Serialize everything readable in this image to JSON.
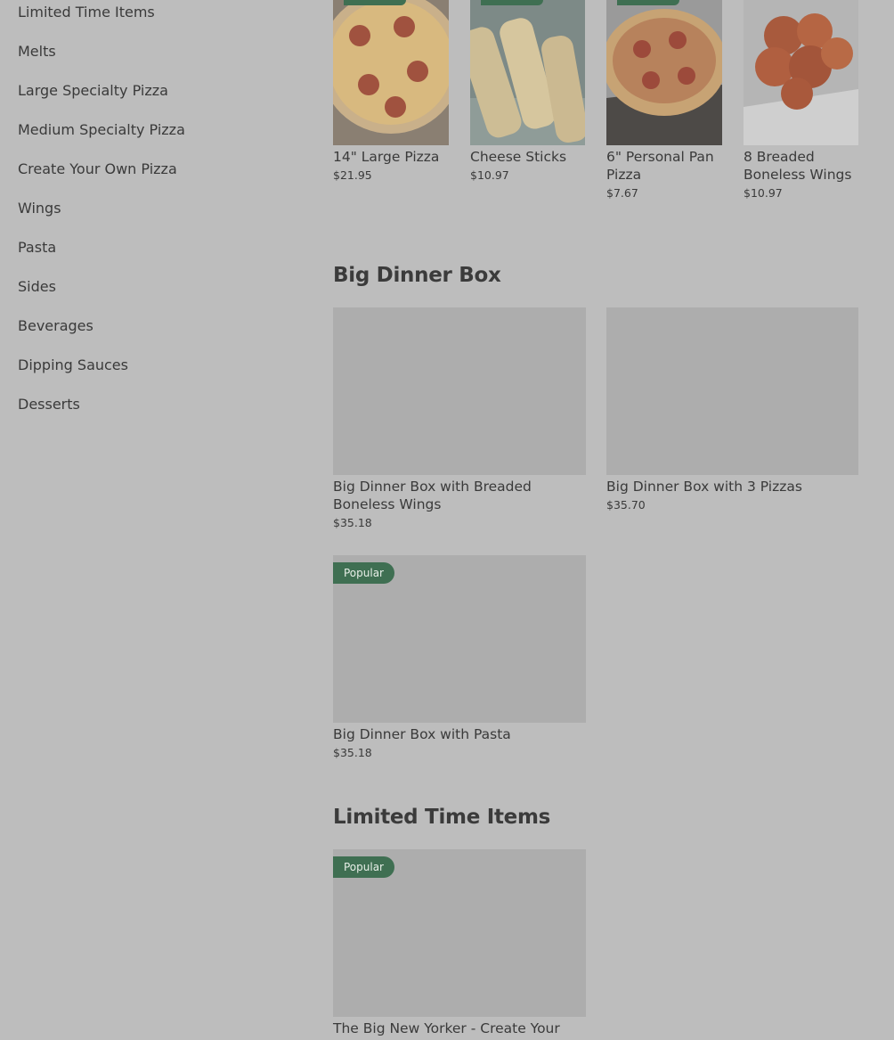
{
  "sidebar": {
    "items": [
      {
        "label": "Limited Time Items"
      },
      {
        "label": "Melts"
      },
      {
        "label": "Large Specialty Pizza"
      },
      {
        "label": "Medium Specialty Pizza"
      },
      {
        "label": "Create Your Own Pizza"
      },
      {
        "label": "Wings"
      },
      {
        "label": "Pasta"
      },
      {
        "label": "Sides"
      },
      {
        "label": "Beverages"
      },
      {
        "label": "Dipping Sauces"
      },
      {
        "label": "Desserts"
      }
    ]
  },
  "top_row": [
    {
      "name": "14\" Large Pizza",
      "price": "$21.95"
    },
    {
      "name": "Cheese Sticks",
      "price": "$10.97"
    },
    {
      "name": "6\" Personal Pan Pizza",
      "price": "$7.67"
    },
    {
      "name": "8 Breaded Boneless Wings",
      "price": "$10.97"
    }
  ],
  "big_dinner_box": {
    "title": "Big Dinner Box",
    "items": [
      {
        "name": "Big Dinner Box with Breaded Boneless Wings",
        "price": "$35.18"
      },
      {
        "name": "Big Dinner Box with 3 Pizzas",
        "price": "$35.70"
      },
      {
        "name": "Big Dinner Box with Pasta",
        "price": "$35.18",
        "badge": "Popular"
      }
    ]
  },
  "limited_time": {
    "title": "Limited Time Items",
    "items": [
      {
        "name": "The Big New Yorker - Create Your",
        "badge": "Popular"
      }
    ]
  },
  "colors": {
    "badge_green": "#3f6f52",
    "overlay_gray": "#bdbdbd",
    "image_placeholder": "#adadad"
  }
}
